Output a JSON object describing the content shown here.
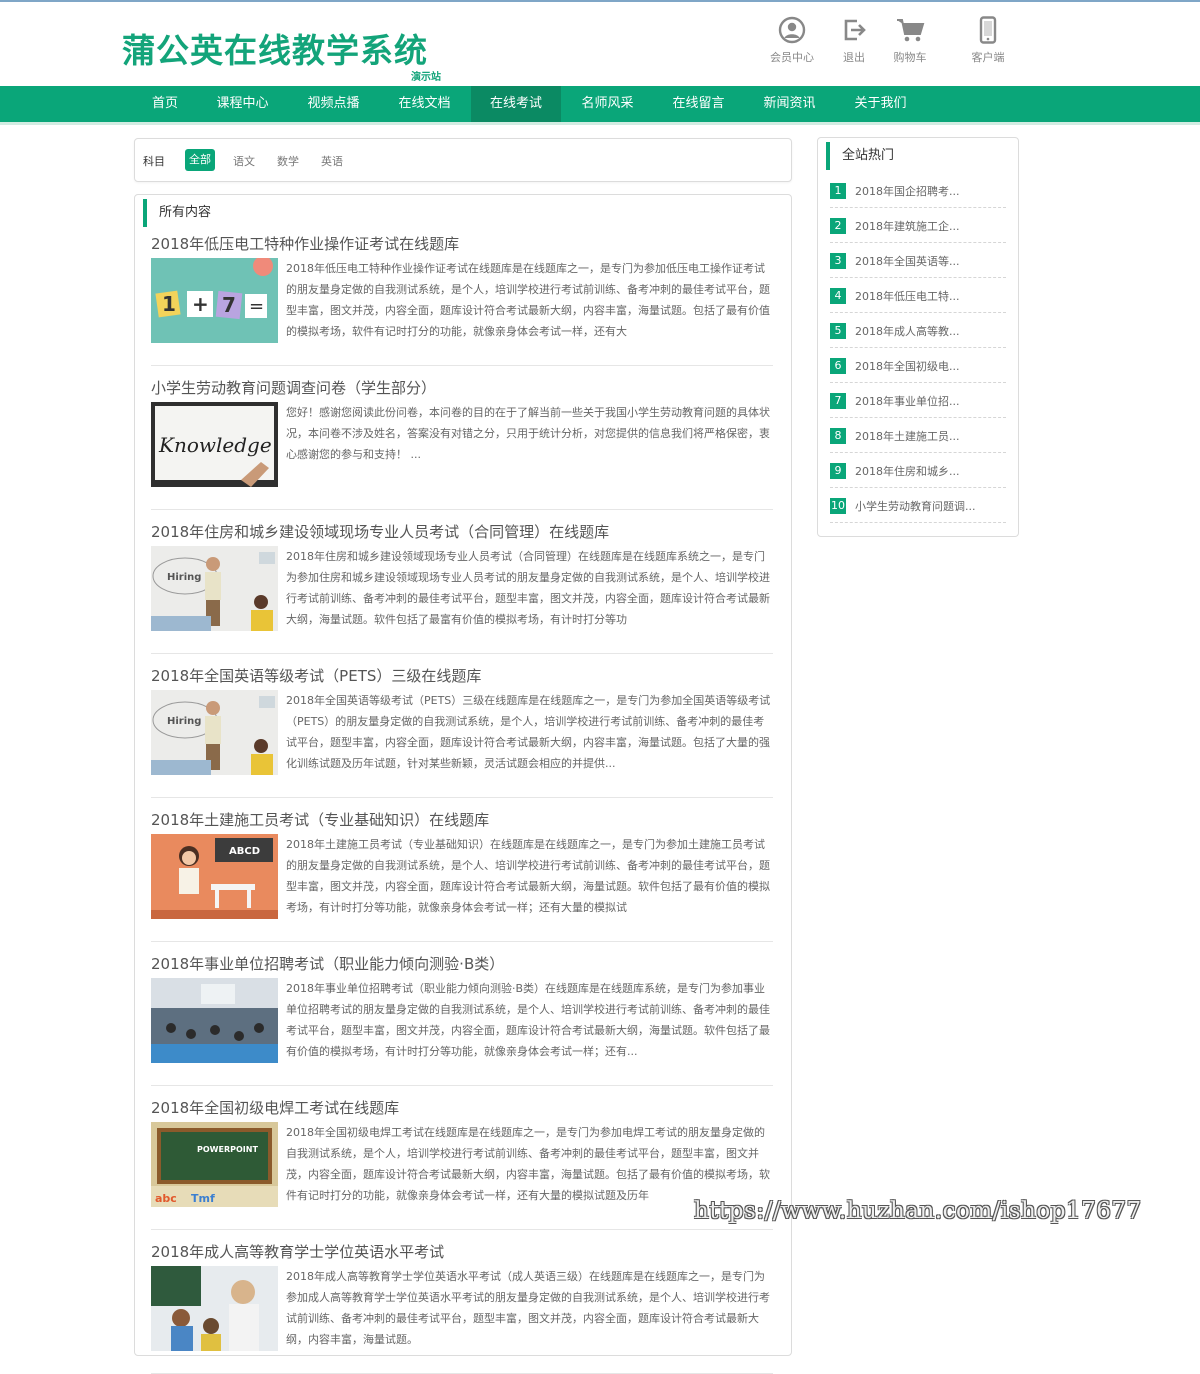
{
  "brand": {
    "logo_text": "蒲公英在线教学系统",
    "logo_sub": "演示站",
    "color": "#13a47a"
  },
  "header_tools": [
    {
      "label": "会员中心",
      "icon": "user-icon"
    },
    {
      "label": "退出",
      "icon": "logout-icon"
    },
    {
      "label": "购物车",
      "icon": "cart-icon"
    },
    {
      "label": "客户端",
      "icon": "mobile-icon"
    }
  ],
  "nav": {
    "items": [
      "首页",
      "课程中心",
      "视频点播",
      "在线文档",
      "在线考试",
      "名师风采",
      "在线留言",
      "新闻资讯",
      "关于我们"
    ],
    "active": "在线考试",
    "bg_color": "#0aa679"
  },
  "filter": {
    "label": "科目",
    "options": [
      "全部",
      "语文",
      "数学",
      "英语"
    ],
    "active": "全部"
  },
  "main": {
    "section_title": "所有内容",
    "articles": [
      {
        "title": "2018年低压电工特种作业操作证考试在线题库",
        "thumb": "math-cards-image",
        "desc": "2018年低压电工特种作业操作证考试在线题库是在线题库之一，是专门为参加低压电工操作证考试的朋友量身定做的自我测试系统，是个人，培训学校进行考试前训练、备考冲刺的最佳考试平台，题型丰富，图文并茂，内容全面，题库设计符合考试最新大纲，内容丰富，海量试题。包括了最有价值的模拟考场，软件有记时打分的功能，就像亲身体会考试一样，还有大"
      },
      {
        "title": "小学生劳动教育问题调查问卷（学生部分）",
        "thumb": "knowledge-image",
        "desc": "您好！感谢您阅读此份问卷，本问卷的目的在于了解当前一些关于我国小学生劳动教育问题的具体状况，本问卷不涉及姓名，答案没有对错之分，只用于统计分析，对您提供的信息我们将严格保密，衷心感谢您的参与和支持！ ..."
      },
      {
        "title": "2018年住房和城乡建设领域现场专业人员考试（合同管理）在线题库",
        "thumb": "hiring-image",
        "desc": "2018年住房和城乡建设领域现场专业人员考试（合同管理）在线题库是在线题库系统之一，是专门为参加住房和城乡建设领域现场专业人员考试的朋友量身定做的自我测试系统，是个人、培训学校进行考试前训练、备考冲刺的最佳考试平台，题型丰富，图文并茂，内容全面，题库设计符合考试最新大纲，海量试题。软件包括了最富有价值的模拟考场，有计时打分等功"
      },
      {
        "title": "2018年全国英语等级考试（PETS）三级在线题库",
        "thumb": "hiring-image",
        "desc": "2018年全国英语等级考试（PETS）三级在线题库是在线题库之一，是专门为参加全国英语等级考试（PETS）的朋友量身定做的自我测试系统，是个人，培训学校进行考试前训练、备考冲刺的最佳考试平台，题型丰富，内容全面，题库设计符合考试最新大纲，内容丰富，海量试题。包括了大量的强化训练试题及历年试题，针对某些新颖，灵活试题会相应的并提供..."
      },
      {
        "title": "2018年土建施工员考试（专业基础知识）在线题库",
        "thumb": "teacher-abcd-image",
        "desc": "2018年土建施工员考试（专业基础知识）在线题库是在线题库之一，是专门为参加土建施工员考试的朋友量身定做的自我测试系统，是个人、培训学校进行考试前训练、备考冲刺的最佳考试平台，题型丰富，图文并茂，内容全面，题库设计符合考试最新大纲，海量试题。软件包括了最有价值的模拟考场，有计时打分等功能，就像亲身体会考试一样；还有大量的模拟试"
      },
      {
        "title": "2018年事业单位招聘考试（职业能力倾向测验·B类）",
        "thumb": "classroom-image",
        "desc": "2018年事业单位招聘考试（职业能力倾向测验·B类）在线题库是在线题库系统，是专门为参加事业单位招聘考试的朋友量身定做的自我测试系统，是个人、培训学校进行考试前训练、备考冲刺的最佳考试平台，题型丰富，图文并茂，内容全面，题库设计符合考试最新大纲，海量试题。软件包括了最有价值的模拟考场，有计时打分等功能，就像亲身体会考试一样；还有..."
      },
      {
        "title": "2018年全国初级电焊工考试在线题库",
        "thumb": "powerpoint-image",
        "desc": "2018年全国初级电焊工考试在线题库是在线题库之一，是专门为参加电焊工考试的朋友量身定做的自我测试系统，是个人，培训学校进行考试前训练、备考冲刺的最佳考试平台，题型丰富，图文并茂，内容全面，题库设计符合考试最新大纲，内容丰富，海量试题。包括了最有价值的模拟考场，软件有记时打分的功能，就像亲身体会考试一样，还有大量的模拟试题及历年"
      },
      {
        "title": "2018年成人高等教育学士学位英语水平考试",
        "thumb": "students-image",
        "desc": "2018年成人高等教育学士学位英语水平考试（成人英语三级）在线题库是在线题库之一，是专门为参加成人高等教育学士学位英语水平考试的朋友量身定做的自我测试系统，是个人、培训学校进行考试前训练、备考冲刺的最佳考试平台，题型丰富，图文并茂，内容全面，题库设计符合考试最新大纲，内容丰富，海量试题。"
      }
    ]
  },
  "sidebar": {
    "title": "全站热门",
    "items": [
      {
        "num": "1",
        "text": "2018年国企招聘考..."
      },
      {
        "num": "2",
        "text": "2018年建筑施工企..."
      },
      {
        "num": "3",
        "text": "2018年全国英语等..."
      },
      {
        "num": "4",
        "text": "2018年低压电工特..."
      },
      {
        "num": "5",
        "text": "2018年成人高等教..."
      },
      {
        "num": "6",
        "text": "2018年全国初级电..."
      },
      {
        "num": "7",
        "text": "2018年事业单位招..."
      },
      {
        "num": "8",
        "text": "2018年土建施工员..."
      },
      {
        "num": "9",
        "text": "2018年住房和城乡..."
      },
      {
        "num": "10",
        "text": "小学生劳动教育问题调..."
      }
    ]
  },
  "watermark": "https://www.huzhan.com/ishop17677"
}
